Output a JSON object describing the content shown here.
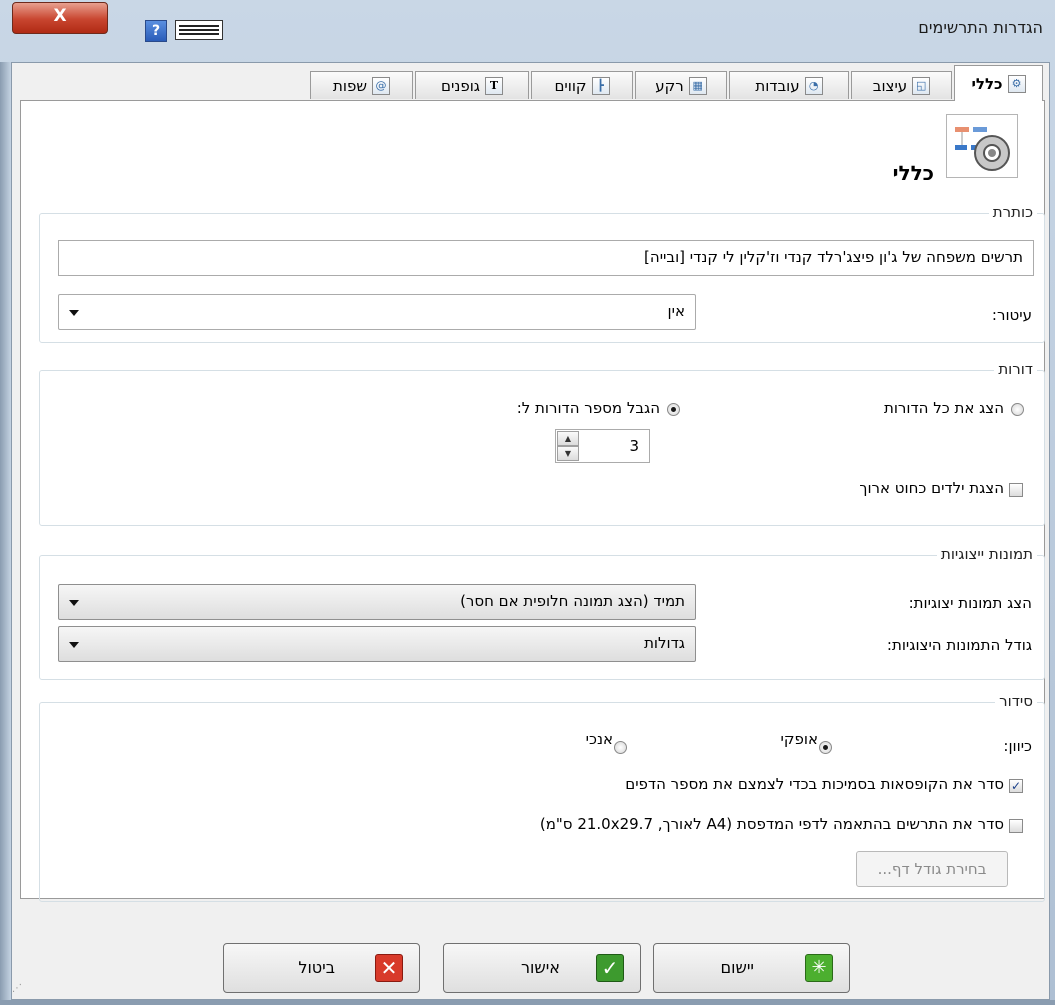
{
  "window": {
    "title": "הגדרות התרשימים",
    "close": "X",
    "help": "?"
  },
  "tabs": [
    {
      "label": "כללי",
      "icon": "general-icon"
    },
    {
      "label": "עיצוב",
      "icon": "design-icon"
    },
    {
      "label": "עובדות",
      "icon": "facts-icon"
    },
    {
      "label": "רקע",
      "icon": "background-icon"
    },
    {
      "label": "קווים",
      "icon": "lines-icon"
    },
    {
      "label": "גופנים",
      "icon": "fonts-icon"
    },
    {
      "label": "שפות",
      "icon": "languages-icon"
    }
  ],
  "header": {
    "title": "כללי",
    "icon": "gear-chart-icon"
  },
  "title_group": {
    "legend": "כותרת",
    "title_value": "תרשים משפחה של ג'ון פיצג'רלד קנדי וז'קלין לי קנדי [ובייה]",
    "decoration_label": "עיטור:",
    "decoration_value": "אין"
  },
  "generations": {
    "legend": "דורות",
    "show_all_label": "הצג את כל הדורות",
    "show_all_selected": false,
    "limit_label": "הגבל מספר הדורות ל:",
    "limit_selected": true,
    "limit_value": "3",
    "long_line_label": "הצגת ילדים כחוט ארוך",
    "long_line_checked": false
  },
  "pictures": {
    "legend": "תמונות ייצוגיות",
    "show_label": "הצג תמונות יצוגיות:",
    "show_value": "תמיד (הצג תמונה חלופית אם חסר)",
    "size_label": "גודל התמונות היצוגיות:",
    "size_value": "גדולות"
  },
  "arrangement": {
    "legend": "סידור",
    "orientation_label": "כיוון:",
    "horizontal_label": "אופקי",
    "horizontal_selected": true,
    "vertical_label": "אנכי",
    "vertical_selected": false,
    "compact_label": "סדר את הקופסאות בסמיכות בכדי לצמצם את מספר הדפים",
    "compact_checked": true,
    "printer_label": "סדר את התרשים בהתאמה לדפי המדפסת (A4 לאורך, 21.0x29.7 ס\"מ)",
    "printer_checked": false,
    "page_size_button": "בחירת גודל דף..."
  },
  "buttons": {
    "apply": "יישום",
    "ok": "אישור",
    "cancel": "ביטול"
  },
  "colors": {
    "ok_green": "#3d9a2e",
    "cancel_red": "#d83a2a",
    "apply_green": "#4caf2f"
  }
}
